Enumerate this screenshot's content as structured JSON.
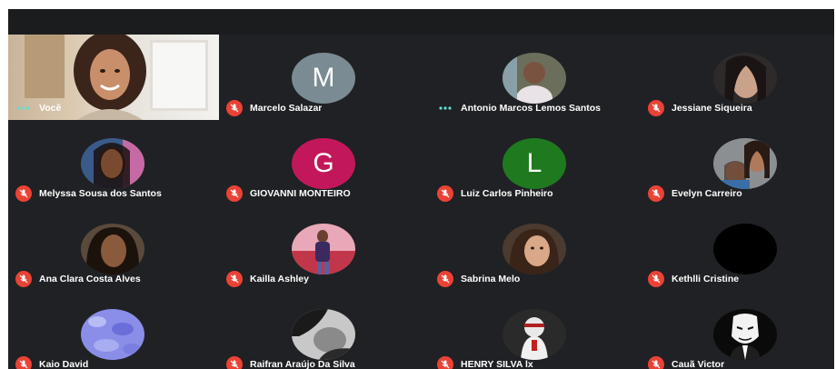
{
  "meeting": {
    "self_label": "Você",
    "participants": [
      {
        "name": "Marcelo Salazar",
        "avatar": "initial",
        "initial": "M",
        "color": "#7a8b93",
        "mic": "muted"
      },
      {
        "name": "Antonio Marcos Lemos Santos",
        "avatar": "photo",
        "mic": "speaking"
      },
      {
        "name": "Jessiane Siqueira",
        "avatar": "photo",
        "mic": "muted"
      },
      {
        "name": "Melyssa Sousa dos Santos",
        "avatar": "photo",
        "mic": "muted"
      },
      {
        "name": "GIOVANNI MONTEIRO",
        "avatar": "initial",
        "initial": "G",
        "color": "#c2185b",
        "mic": "muted"
      },
      {
        "name": "Luiz Carlos Pinheiro",
        "avatar": "initial",
        "initial": "L",
        "color": "#1f7a1f",
        "mic": "muted"
      },
      {
        "name": "Evelyn Carreiro",
        "avatar": "photo",
        "mic": "muted"
      },
      {
        "name": "Ana Clara Costa Alves",
        "avatar": "photo",
        "mic": "muted"
      },
      {
        "name": "Kailla Ashley",
        "avatar": "photo",
        "mic": "muted"
      },
      {
        "name": "Sabrina Melo",
        "avatar": "photo",
        "mic": "muted"
      },
      {
        "name": "Kethlli Cristine",
        "avatar": "photo",
        "mic": "muted"
      },
      {
        "name": "Kaio David",
        "avatar": "photo",
        "mic": "muted"
      },
      {
        "name": "Raifran Araújo Da Silva",
        "avatar": "photo",
        "mic": "muted"
      },
      {
        "name": "HENRY SILVA lx",
        "avatar": "photo",
        "mic": "muted"
      },
      {
        "name": "Cauã Victor",
        "avatar": "photo",
        "mic": "muted"
      }
    ]
  },
  "colors": {
    "background": "#202124",
    "mute_badge": "#ea4335",
    "speaking_dots": "#5fe0d3",
    "active_outline": "#5fe0d3"
  },
  "icons": {
    "muted": "mic-off-icon",
    "speaking": "audio-dots-icon"
  }
}
